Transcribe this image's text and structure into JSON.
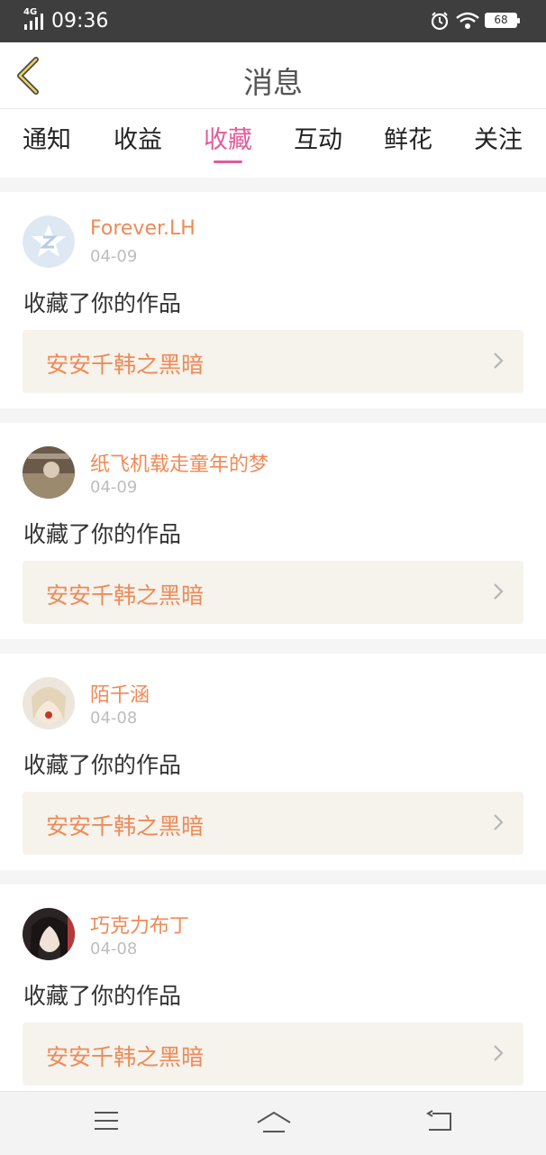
{
  "status_bar": {
    "network": "4G",
    "time": "09:36",
    "battery": "68"
  },
  "header": {
    "title": "消息"
  },
  "tabs": [
    {
      "label": "通知",
      "active": false
    },
    {
      "label": "收益",
      "active": false
    },
    {
      "label": "收藏",
      "active": true
    },
    {
      "label": "互动",
      "active": false
    },
    {
      "label": "鲜花",
      "active": false
    },
    {
      "label": "关注",
      "active": false
    }
  ],
  "messages": [
    {
      "user": "Forever.LH",
      "date": "04-09",
      "action": "收藏了你的作品",
      "work": "安安千韩之黑暗"
    },
    {
      "user": "纸飞机载走童年的梦",
      "date": "04-09",
      "action": "收藏了你的作品",
      "work": "安安千韩之黑暗"
    },
    {
      "user": "陌千涵",
      "date": "04-08",
      "action": "收藏了你的作品",
      "work": "安安千韩之黑暗"
    },
    {
      "user": "巧克力布丁",
      "date": "04-08",
      "action": "收藏了你的作品",
      "work": "安安千韩之黑暗"
    }
  ],
  "colors": {
    "accent": "#e25c9b",
    "name": "#ef8a57",
    "date": "#bdbdbd",
    "card_bg": "#f5f3ec"
  },
  "nav": {
    "icons": [
      "menu-icon",
      "home-icon",
      "back-icon"
    ]
  }
}
